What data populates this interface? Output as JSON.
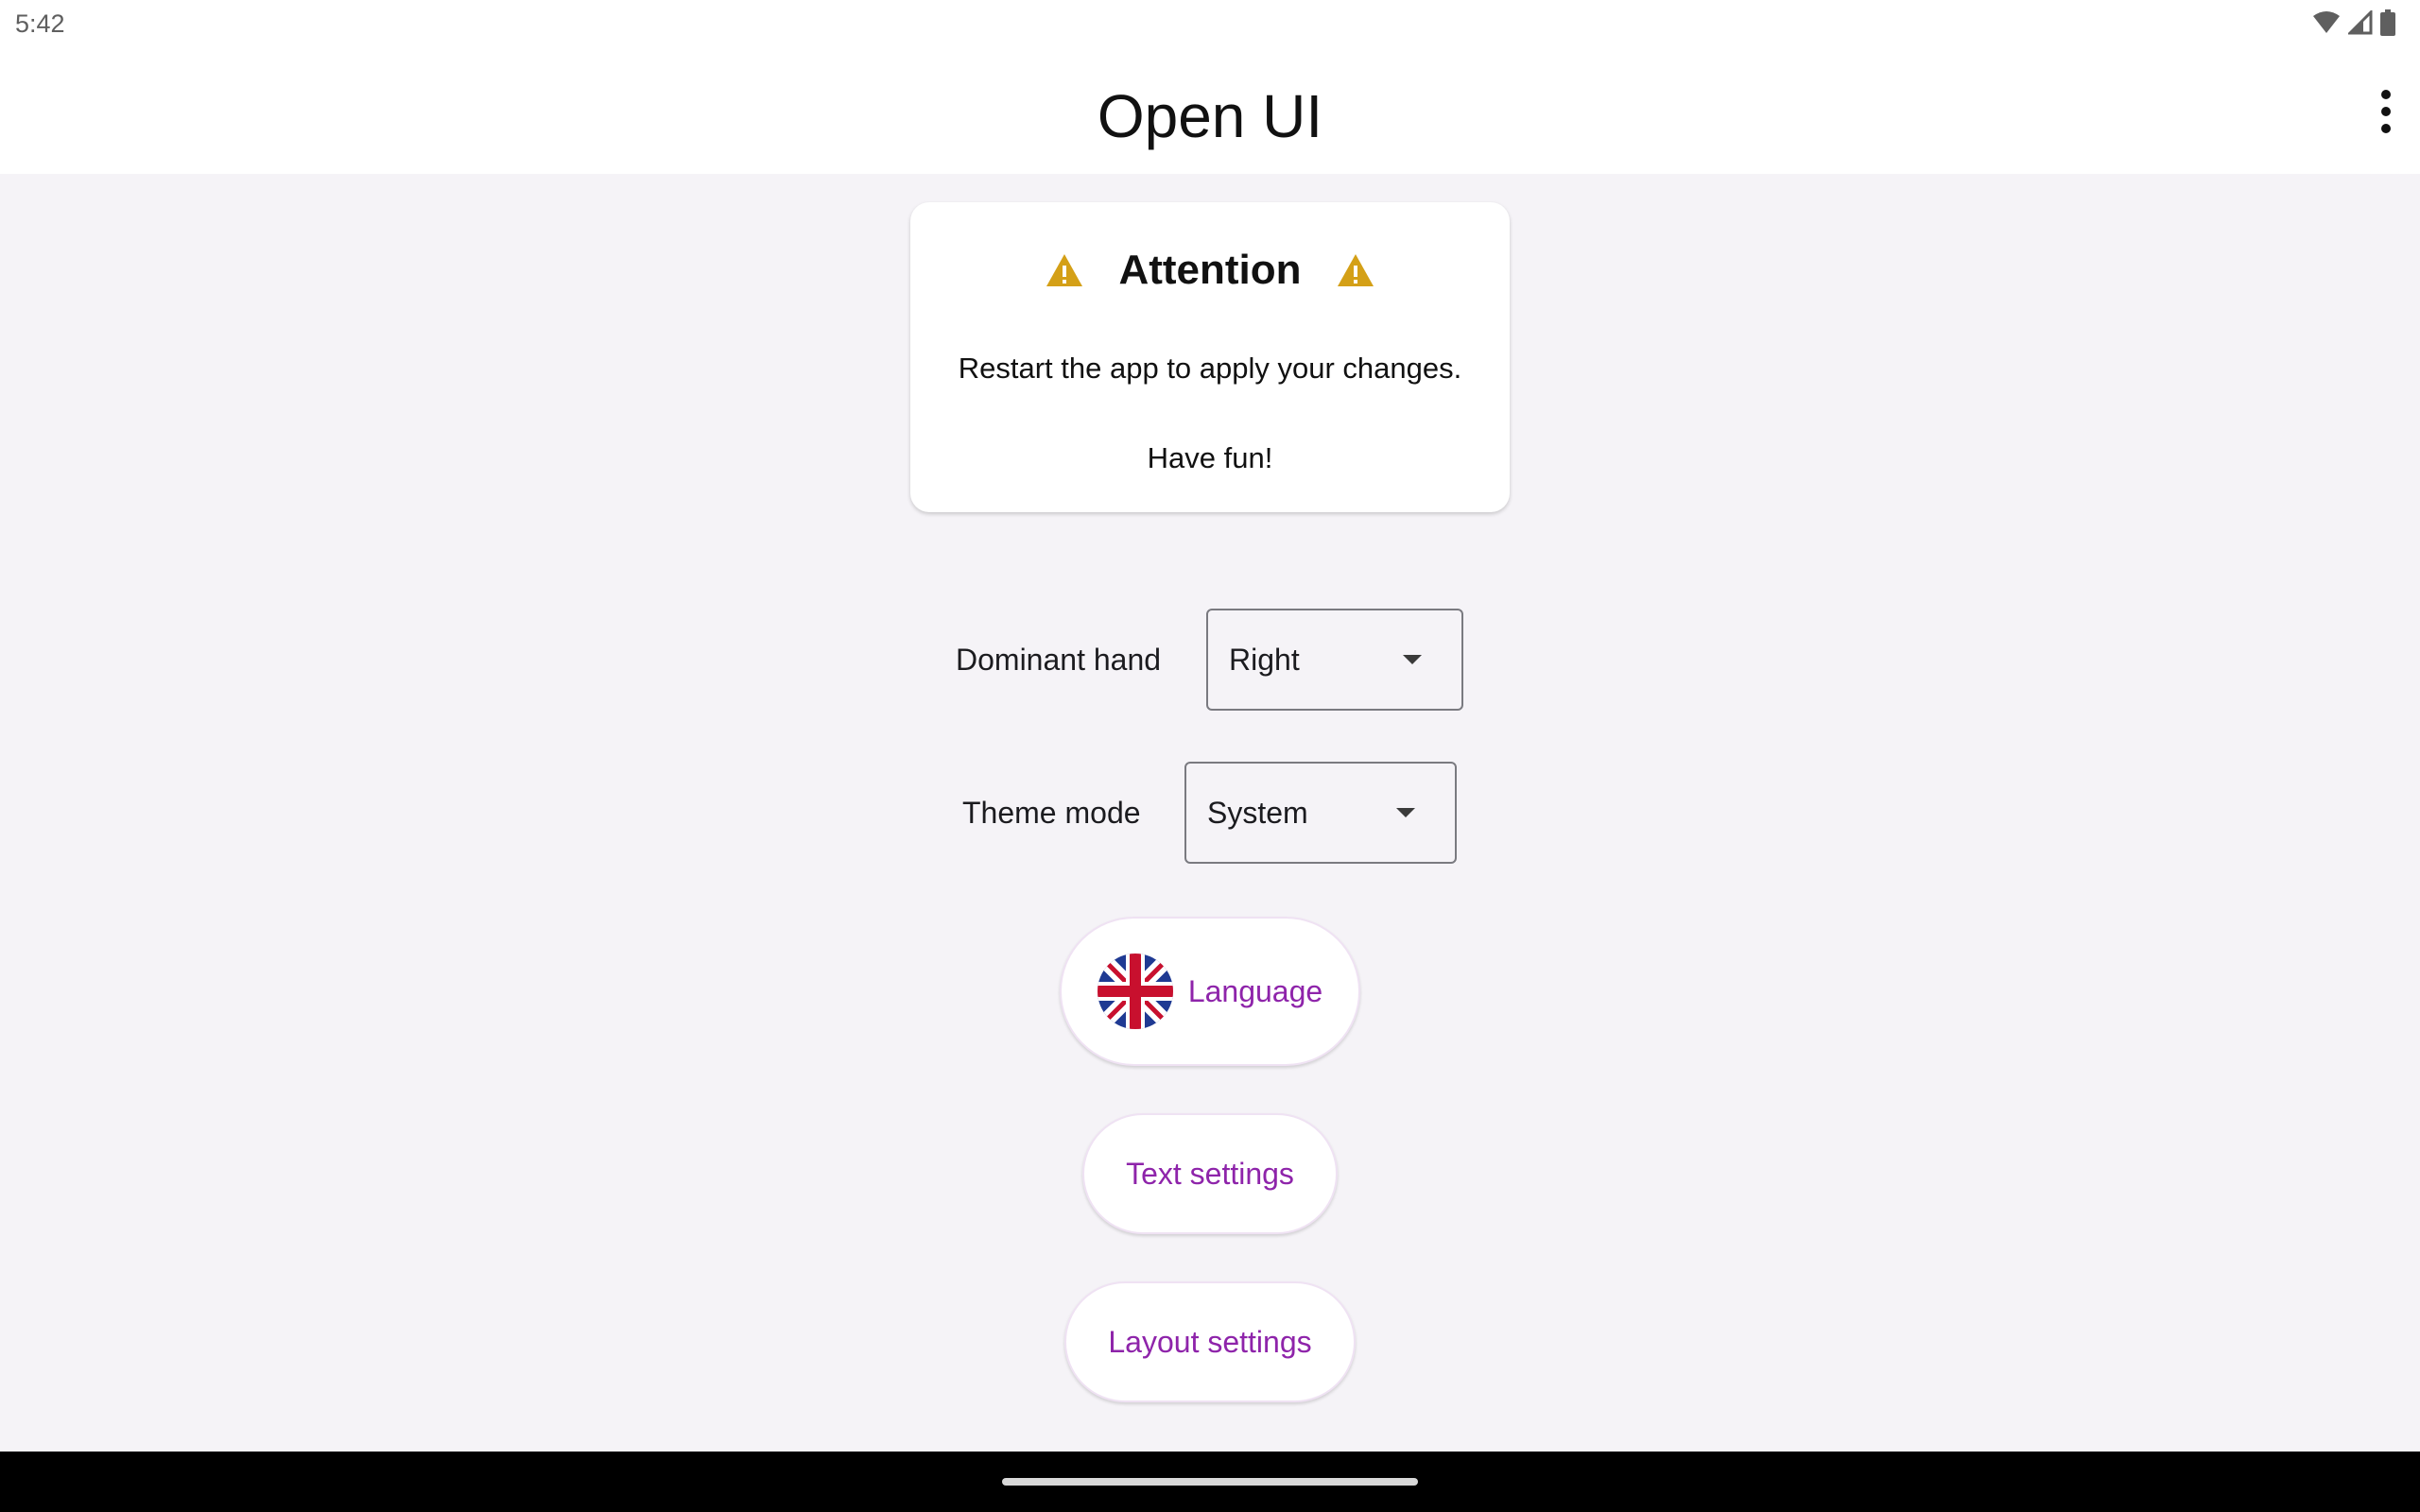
{
  "status_bar": {
    "time": "5:42",
    "icons": [
      "wifi-icon",
      "cell-signal-icon",
      "battery-icon"
    ]
  },
  "app_bar": {
    "title": "Open UI",
    "menu_icon": "more-vert-icon"
  },
  "attention_card": {
    "title": "Attention",
    "icon": "warning-icon",
    "icon_color": "#d4a017",
    "message": "Restart the app to apply your changes.",
    "footer": "Have fun!"
  },
  "settings": {
    "dominant_hand": {
      "label": "Dominant hand",
      "value": "Right"
    },
    "theme_mode": {
      "label": "Theme mode",
      "value": "System"
    }
  },
  "buttons": {
    "language": {
      "label": "Language",
      "icon": "uk-flag-icon"
    },
    "text_settings": {
      "label": "Text settings"
    },
    "layout_settings": {
      "label": "Layout settings"
    }
  },
  "colors": {
    "accent": "#8e24aa",
    "background": "#f5f3f7"
  }
}
